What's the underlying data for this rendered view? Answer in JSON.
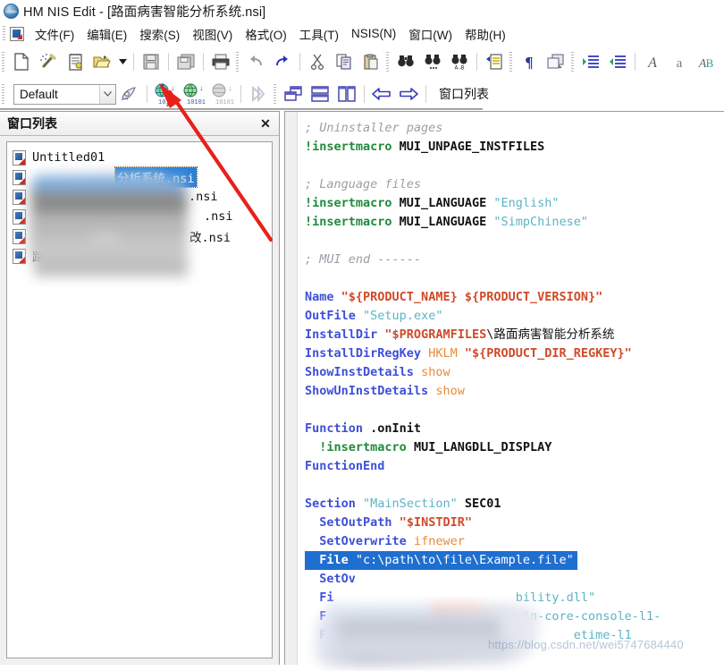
{
  "window": {
    "app_icon": "globe-icon",
    "title": "HM NIS Edit - [路面病害智能分析系统.nsi]"
  },
  "menubar": {
    "doc_icon": "document-icon",
    "items": [
      {
        "name": "file",
        "label": "文件(F)"
      },
      {
        "name": "edit",
        "label": "编辑(E)"
      },
      {
        "name": "search",
        "label": "搜索(S)"
      },
      {
        "name": "view",
        "label": "视图(V)"
      },
      {
        "name": "format",
        "label": "格式(O)"
      },
      {
        "name": "tools",
        "label": "工具(T)"
      },
      {
        "name": "nsis",
        "label": "NSIS(N)"
      },
      {
        "name": "window",
        "label": "窗口(W)"
      },
      {
        "name": "help",
        "label": "帮助(H)"
      }
    ]
  },
  "toolbar1": {
    "buttons": [
      {
        "name": "new-file-icon",
        "icon": "page"
      },
      {
        "name": "new-wizard-icon",
        "icon": "wand"
      },
      {
        "name": "new-script-icon",
        "icon": "notepad"
      },
      {
        "name": "open-file-icon",
        "icon": "folder-open"
      },
      {
        "name": "open-dropdown-icon",
        "icon": "caret-down"
      },
      {
        "name": "save-icon",
        "icon": "floppy"
      },
      {
        "name": "save-all-icon",
        "icon": "floppy-stack"
      },
      {
        "name": "print-icon",
        "icon": "printer"
      },
      {
        "name": "undo-icon",
        "icon": "undo"
      },
      {
        "name": "redo-icon",
        "icon": "redo"
      },
      {
        "name": "cut-icon",
        "icon": "scissors"
      },
      {
        "name": "copy-icon",
        "icon": "copy"
      },
      {
        "name": "paste-icon",
        "icon": "clipboard"
      },
      {
        "name": "find-icon",
        "icon": "binoculars"
      },
      {
        "name": "find-next-icon",
        "icon": "binoculars-dots"
      },
      {
        "name": "replace-icon",
        "icon": "binoculars-ab"
      },
      {
        "name": "goto-line-icon",
        "icon": "goto-page"
      },
      {
        "name": "show-marks-icon",
        "icon": "pilcrow"
      },
      {
        "name": "duplicate-icon",
        "icon": "windows-stack"
      },
      {
        "name": "indent-icon",
        "icon": "indent-right"
      },
      {
        "name": "outdent-icon",
        "icon": "indent-left"
      },
      {
        "name": "uppercase-icon",
        "icon": "A-big"
      },
      {
        "name": "lowercase-icon",
        "icon": "a-small"
      },
      {
        "name": "invert-case-icon",
        "icon": "Ab"
      },
      {
        "name": "quote-icon",
        "icon": "quote-c"
      }
    ]
  },
  "toolbar2": {
    "style_combo": {
      "value": "Default",
      "arrow_icon": "chevron-down-icon"
    },
    "buttons": [
      {
        "name": "script-settings-icon",
        "icon": "script-gear"
      },
      {
        "name": "compile-icon",
        "icon": "globe-compile-1"
      },
      {
        "name": "compile-run-icon",
        "icon": "globe-compile-2"
      },
      {
        "name": "compile-test-icon",
        "icon": "globe-compile-3"
      },
      {
        "name": "run-icon",
        "icon": "play"
      },
      {
        "name": "cascade-icon",
        "icon": "cascade-windows"
      },
      {
        "name": "tile-horizontal-icon",
        "icon": "tile-horizontal"
      },
      {
        "name": "tile-vertical-icon",
        "icon": "tile-vertical"
      },
      {
        "name": "previous-window-icon",
        "icon": "arrow-left"
      },
      {
        "name": "next-window-icon",
        "icon": "arrow-right"
      }
    ],
    "window_list_label": "窗口列表"
  },
  "window_list_panel": {
    "title": "窗口列表",
    "close_label": "✕",
    "items": [
      {
        "name": "untitled01",
        "label": "Untitled01",
        "selected": false,
        "blurred": false
      },
      {
        "name": "item-2",
        "label": "分析系统.nsi",
        "selected": true,
        "blurred": true
      },
      {
        "name": "item-3",
        "label": ".nsi",
        "selected": false,
        "blurred": true
      },
      {
        "name": "item-4",
        "label": ".nsi",
        "selected": false,
        "blurred": true
      },
      {
        "name": "item-5",
        "label": "改.nsi",
        "selected": false,
        "blurred": true
      },
      {
        "name": "item-6",
        "label": "路面.nsi",
        "selected": false,
        "blurred": true
      }
    ]
  },
  "editor": {
    "selected_line_index": 24,
    "lines": [
      {
        "i": 0,
        "tokens": [
          {
            "t": "comment",
            "v": "; Uninstaller pages"
          }
        ]
      },
      {
        "i": 1,
        "tokens": [
          {
            "t": "macro",
            "v": "!insertmacro"
          },
          {
            "t": "plain",
            "v": " MUI_UNPAGE_INSTFILES"
          }
        ]
      },
      {
        "i": 2,
        "tokens": []
      },
      {
        "i": 3,
        "tokens": [
          {
            "t": "comment",
            "v": "; Language files"
          }
        ]
      },
      {
        "i": 4,
        "tokens": [
          {
            "t": "macro",
            "v": "!insertmacro"
          },
          {
            "t": "plain",
            "v": " MUI_LANGUAGE "
          },
          {
            "t": "str",
            "v": "\"English\""
          }
        ]
      },
      {
        "i": 5,
        "tokens": [
          {
            "t": "macro",
            "v": "!insertmacro"
          },
          {
            "t": "plain",
            "v": " MUI_LANGUAGE "
          },
          {
            "t": "str",
            "v": "\"SimpChinese\""
          }
        ]
      },
      {
        "i": 6,
        "tokens": []
      },
      {
        "i": 7,
        "tokens": [
          {
            "t": "comment",
            "v": "; MUI end ------"
          }
        ]
      },
      {
        "i": 8,
        "tokens": []
      },
      {
        "i": 9,
        "tokens": [
          {
            "t": "kw",
            "v": "Name"
          },
          {
            "t": "plain",
            "v": " "
          },
          {
            "t": "var",
            "v": "\"${PRODUCT_NAME} ${PRODUCT_VERSION}\""
          }
        ]
      },
      {
        "i": 10,
        "tokens": [
          {
            "t": "kw",
            "v": "OutFile"
          },
          {
            "t": "plain",
            "v": " "
          },
          {
            "t": "str",
            "v": "\"Setup.exe\""
          }
        ]
      },
      {
        "i": 11,
        "tokens": [
          {
            "t": "kw",
            "v": "InstallDir"
          },
          {
            "t": "plain",
            "v": " "
          },
          {
            "t": "var",
            "v": "\"$PROGRAMFILES"
          },
          {
            "t": "cn",
            "v": "\\路面病害智能分析系统"
          }
        ]
      },
      {
        "i": 12,
        "tokens": [
          {
            "t": "kw",
            "v": "InstallDirRegKey"
          },
          {
            "t": "plain",
            "v": " "
          },
          {
            "t": "param",
            "v": "HKLM"
          },
          {
            "t": "plain",
            "v": " "
          },
          {
            "t": "var",
            "v": "\"${PRODUCT_DIR_REGKEY}\""
          }
        ]
      },
      {
        "i": 13,
        "tokens": [
          {
            "t": "kw",
            "v": "ShowInstDetails"
          },
          {
            "t": "plain",
            "v": " "
          },
          {
            "t": "param",
            "v": "show"
          }
        ]
      },
      {
        "i": 14,
        "tokens": [
          {
            "t": "kw",
            "v": "ShowUnInstDetails"
          },
          {
            "t": "plain",
            "v": " "
          },
          {
            "t": "param",
            "v": "show"
          }
        ]
      },
      {
        "i": 15,
        "tokens": []
      },
      {
        "i": 16,
        "tokens": [
          {
            "t": "kw",
            "v": "Function"
          },
          {
            "t": "plain",
            "v": " .onInit"
          }
        ]
      },
      {
        "i": 17,
        "tokens": [
          {
            "t": "plain",
            "v": "  "
          },
          {
            "t": "macro",
            "v": "!insertmacro"
          },
          {
            "t": "plain",
            "v": " MUI_LANGDLL_DISPLAY"
          }
        ]
      },
      {
        "i": 18,
        "tokens": [
          {
            "t": "kw",
            "v": "FunctionEnd"
          }
        ]
      },
      {
        "i": 19,
        "tokens": []
      },
      {
        "i": 20,
        "tokens": [
          {
            "t": "kw",
            "v": "Section"
          },
          {
            "t": "plain",
            "v": " "
          },
          {
            "t": "str",
            "v": "\"MainSection\""
          },
          {
            "t": "plain",
            "v": " SEC01"
          }
        ]
      },
      {
        "i": 21,
        "tokens": [
          {
            "t": "plain",
            "v": "  "
          },
          {
            "t": "kw",
            "v": "SetOutPath"
          },
          {
            "t": "plain",
            "v": " "
          },
          {
            "t": "var",
            "v": "\"$INSTDIR\""
          }
        ]
      },
      {
        "i": 22,
        "tokens": [
          {
            "t": "plain",
            "v": "  "
          },
          {
            "t": "kw",
            "v": "SetOverwrite"
          },
          {
            "t": "plain",
            "v": " "
          },
          {
            "t": "param",
            "v": "ifnewer"
          }
        ]
      },
      {
        "i": 23,
        "tokens": [
          {
            "t": "kw",
            "v": "  File "
          },
          {
            "t": "str",
            "v": "\"c:\\path\\to\\file\\Example.file\""
          }
        ],
        "selected": true
      },
      {
        "i": 24,
        "tokens": [
          {
            "t": "plain",
            "v": "  "
          },
          {
            "t": "kw",
            "v": "SetOv"
          },
          {
            "t": "param",
            "v": "                       "
          }
        ]
      },
      {
        "i": 25,
        "tokens": [
          {
            "t": "plain",
            "v": "  "
          },
          {
            "t": "kw",
            "v": "Fi"
          },
          {
            "t": "str",
            "v": "                         bility.dll\""
          }
        ]
      },
      {
        "i": 26,
        "tokens": [
          {
            "t": "plain",
            "v": "  "
          },
          {
            "t": "kw",
            "v": "F"
          },
          {
            "t": "str",
            "v": "                          win-core-console-l1-"
          }
        ]
      },
      {
        "i": 27,
        "tokens": [
          {
            "t": "plain",
            "v": "  "
          },
          {
            "t": "kw",
            "v": "File"
          },
          {
            "t": "str",
            "v": "                               etime-l1"
          }
        ]
      }
    ]
  },
  "annotation": {
    "arrow_color": "#e8201b",
    "arrow_name": "red-pointer-arrow",
    "target": "compile-icon"
  },
  "watermark": {
    "text": "https://blog.csdn.net/wei5747684440"
  },
  "colors": {
    "selection_blue": "#1f6fd0",
    "keyword_blue": "#3e4fd8",
    "string_cyan": "#5bb4c4",
    "macro_green": "#1f8a3b",
    "variable_red": "#d04a2a",
    "param_orange": "#e98a38",
    "comment_gray": "#9aa0a6",
    "panel_gray": "#f0f0f0"
  }
}
